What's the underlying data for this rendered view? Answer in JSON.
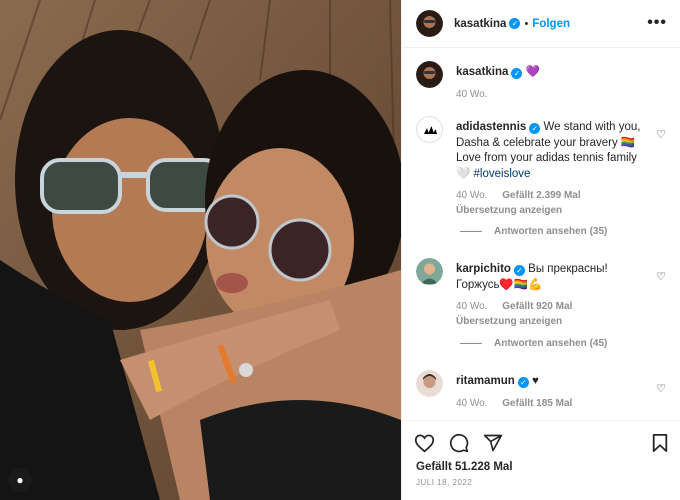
{
  "post": {
    "author": "kasatkina",
    "follow_label": "Folgen",
    "more_label": "•••",
    "dot": "•"
  },
  "caption": {
    "username": "kasatkina",
    "emoji": "💜",
    "time": "40 Wo."
  },
  "comments": [
    {
      "username": "adidastennis",
      "text": "We stand with you, Dasha & celebrate your bravery 🏳️‍🌈 Love from your adidas tennis family 🤍 ",
      "hashtag": "#loveislove",
      "time": "40 Wo.",
      "likes": "Gefällt 2.399 Mal",
      "translate": "Übersetzung anzeigen",
      "replies": "Antworten ansehen (35)"
    },
    {
      "username": "karpichito",
      "text": "Вы прекрасны! Горжусь♥️🏳️‍🌈💪",
      "time": "40 Wo.",
      "likes": "Gefällt 920 Mal",
      "translate": "Übersetzung anzeigen",
      "replies": "Antworten ansehen (45)"
    },
    {
      "username": "ritamamun",
      "text": "♥",
      "time": "40 Wo.",
      "likes": "Gefällt 185 Mal"
    }
  ],
  "footer": {
    "likes": "Gefällt 51.228 Mal",
    "date": "JULI 18, 2022"
  },
  "icons": {
    "heart": "heart-icon",
    "comment": "comment-icon",
    "share": "share-icon",
    "save": "bookmark-icon"
  },
  "colors": {
    "accent": "#0095f6",
    "muted": "#8e8e8e",
    "hashtag": "#00376b"
  }
}
